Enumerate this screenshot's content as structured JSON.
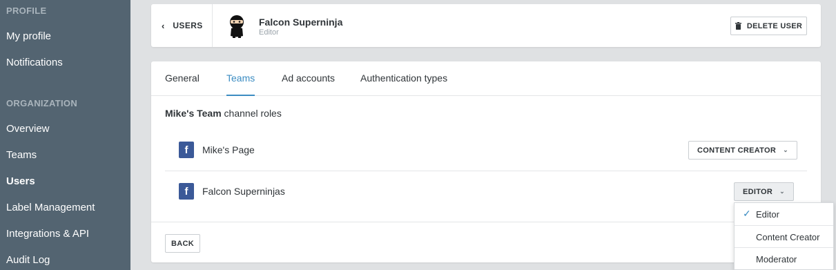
{
  "sidebar": {
    "profile_heading": "PROFILE",
    "profile_items": [
      "My profile",
      "Notifications"
    ],
    "org_heading": "ORGANIZATION",
    "org_items": [
      "Overview",
      "Teams",
      "Users",
      "Label Management",
      "Integrations & API",
      "Audit Log"
    ],
    "active_item": "Users"
  },
  "header": {
    "back_label": "USERS",
    "user_name": "Falcon Superninja",
    "user_role": "Editor",
    "delete_label": "DELETE USER"
  },
  "tabs": [
    "General",
    "Teams",
    "Ad accounts",
    "Authentication types"
  ],
  "active_tab": "Teams",
  "section": {
    "team_name": "Mike's Team",
    "suffix": " channel roles"
  },
  "channels": [
    {
      "name": "Mike's Page",
      "role": "CONTENT CREATOR",
      "icon": "facebook-icon"
    },
    {
      "name": "Falcon Superninjas",
      "role": "EDITOR",
      "icon": "facebook-icon"
    }
  ],
  "footer": {
    "back_label": "BACK"
  },
  "dropdown": {
    "options": [
      "Editor",
      "Content Creator",
      "Moderator"
    ],
    "selected": "Editor"
  },
  "colors": {
    "sidebar_bg": "#536471",
    "accent": "#3b8cc2",
    "facebook": "#3b5998"
  }
}
